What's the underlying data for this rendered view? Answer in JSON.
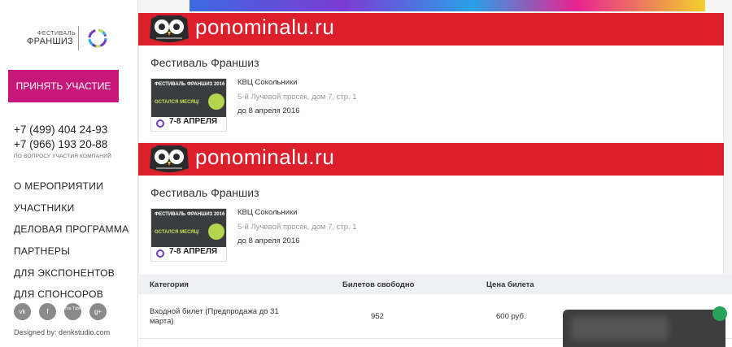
{
  "sidebar": {
    "logo_small": "ФЕСТИВАЛЬ",
    "logo_big": "ФРАНШИЗ",
    "join_button": "ПРИНЯТЬ УЧАСТИЕ",
    "phone1": "+7 (499) 404 24-93",
    "phone2": "+7 (966) 193 20-88",
    "phone_note": "ПО ВОПРОСУ УЧАСТИЯ КОМПАНИЙ",
    "menu": [
      "О МЕРОПРИЯТИИ",
      "УЧАСТНИКИ",
      "ДЕЛОВАЯ ПРОГРАММА",
      "ПАРТНЕРЫ",
      "ДЛЯ ЭКСПОНЕНТОВ",
      "ДЛЯ СПОНСОРОВ"
    ],
    "socials": [
      "vk",
      "f",
      "You Tube",
      "g+"
    ],
    "designed_by": "Designed by: denkstudio.com"
  },
  "banners": [
    {
      "brand": "ponominalu.ru"
    },
    {
      "brand": "ponominalu.ru"
    }
  ],
  "events": [
    {
      "title": "Фестиваль Франшиз",
      "venue": "КВЦ Сокольники",
      "address": "5-й Лучевой просек, дом 7, стр. 1",
      "date": "до 8 апреля 2016",
      "poster": {
        "header": "ФЕСТИВАЛЬ ФРАНШИЗ 2016",
        "message": "ОСТАЛСЯ МЕСЯЦ!",
        "dates": "7-8 АПРЕЛЯ"
      }
    },
    {
      "title": "Фестиваль Франшиз",
      "venue": "КВЦ Сокольники",
      "address": "5-й Лучевой просек, дом 7, стр. 1",
      "date": "до 8 апреля 2016",
      "poster": {
        "header": "ФЕСТИВАЛЬ ФРАНШИЗ 2016",
        "message": "ОСТАЛСЯ МЕСЯЦ!",
        "dates": "7-8 АПРЕЛЯ"
      }
    }
  ],
  "tickets": {
    "headers": [
      "Категория",
      "Билетов свободно",
      "Цена билета"
    ],
    "rows": [
      {
        "category": "Входной билет (Предпродажа до 31 марта)",
        "available": "952",
        "price": "600 руб."
      }
    ]
  },
  "colors": {
    "accent": "#c8177a",
    "banner": "#dc1f2b"
  }
}
